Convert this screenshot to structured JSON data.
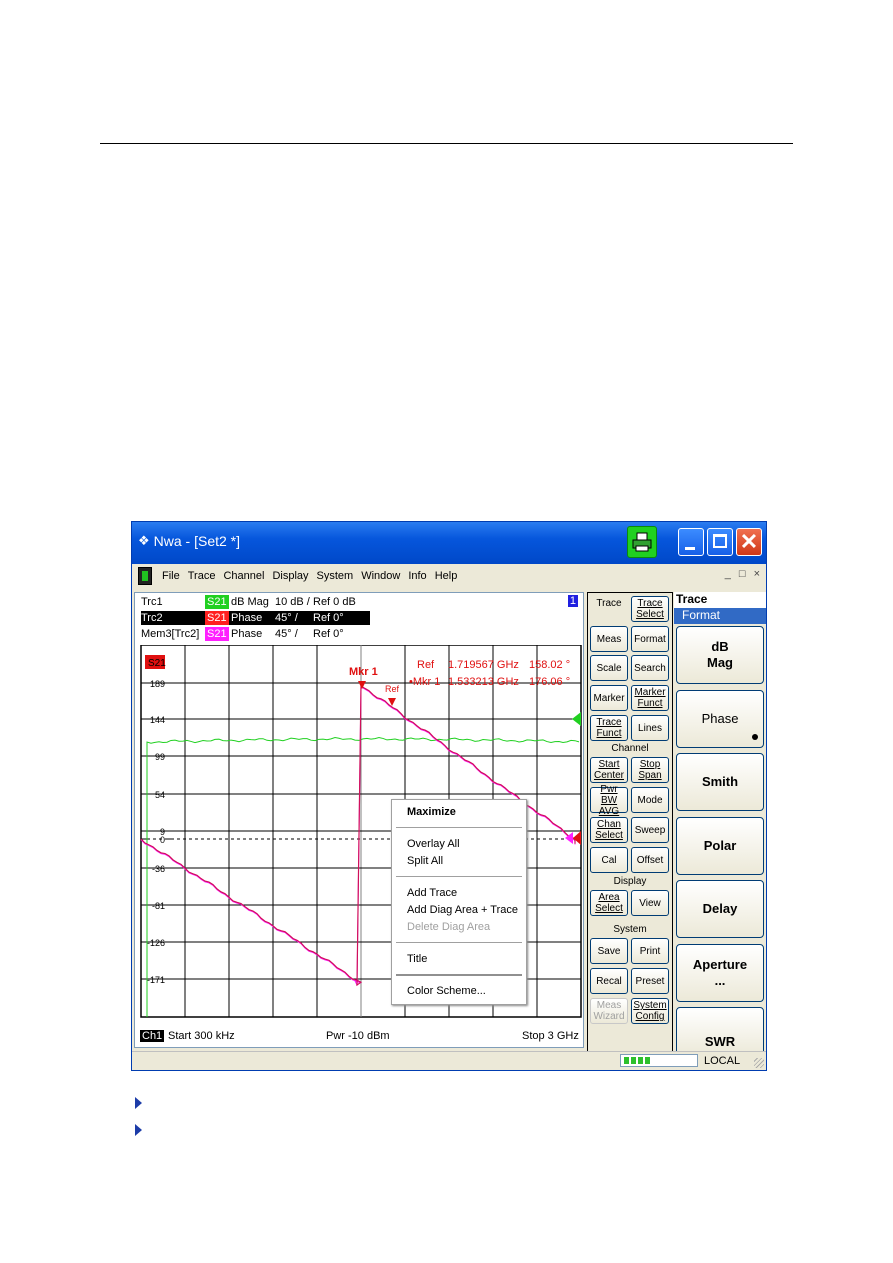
{
  "window": {
    "title": "Nwa - [Set2 *]",
    "app_icon": "rohde-schwarz-diamond-icon"
  },
  "menu": [
    "File",
    "Trace",
    "Channel",
    "Display",
    "System",
    "Window",
    "Info",
    "Help"
  ],
  "mdi_controls": [
    "_",
    "□",
    "×"
  ],
  "traces": [
    {
      "name": "Trc1",
      "param": "S21",
      "param_color": "#20d020",
      "format": "dB Mag",
      "scale": "10 dB /",
      "ref": "Ref 0 dB",
      "selected": false
    },
    {
      "name": "Trc2",
      "param": "S21",
      "param_color": "#ff2020",
      "format": "Phase",
      "scale": "45° /",
      "ref": "Ref 0°",
      "selected": true
    },
    {
      "name": "Mem3[Trc2]",
      "param": "S21",
      "param_color": "#ff20ff",
      "format": "Phase",
      "scale": "45° /",
      "ref": "Ref 0°",
      "selected": false
    }
  ],
  "channel_number": "1",
  "diagram": {
    "active_param_badge": "S21",
    "y_ticks": [
      "189",
      "144",
      "99",
      "54",
      "9",
      "0",
      "-36",
      "-81",
      "-126",
      "-171"
    ],
    "marker_readout": [
      {
        "label": "Ref",
        "freq": "1.719567 GHz",
        "value": "158.02 °"
      },
      {
        "label": "•Mkr 1",
        "freq": "1.533213 GHz",
        "value": "176.06 °"
      }
    ],
    "marker1_label": "Mkr 1",
    "ref_marker_label": "Ref",
    "footer": {
      "channel": "Ch1",
      "start": "Start  300 kHz",
      "power": "Pwr  -10 dBm",
      "stop": "Stop  3 GHz"
    }
  },
  "context_menu": {
    "items": [
      {
        "label": "Maximize",
        "bold": true,
        "disabled": false
      },
      {
        "label": "Overlay All",
        "disabled": false
      },
      {
        "label": "Split All",
        "disabled": false
      },
      {
        "label": "Add Trace",
        "disabled": false
      },
      {
        "label": "Add Diag Area + Trace",
        "disabled": false
      },
      {
        "label": "Delete Diag Area",
        "disabled": true
      },
      {
        "label": "Title",
        "disabled": false
      },
      {
        "label": "Color Scheme...",
        "disabled": false
      }
    ]
  },
  "softkeys": {
    "trace_label": "Trace",
    "trace_select": "Trace Select",
    "meas": "Meas",
    "format": "Format",
    "scale": "Scale",
    "search": "Search",
    "marker": "Marker",
    "marker_funct": "Marker Funct",
    "trace_funct": "Trace Funct",
    "lines": "Lines",
    "channel_label": "Channel",
    "start_center": "Start Center",
    "stop_span": "Stop Span",
    "pwr_bw_avg": "Pwr BW AVG",
    "mode": "Mode",
    "chan_select": "Chan Select",
    "sweep": "Sweep",
    "cal": "Cal",
    "offset": "Offset",
    "display_label": "Display",
    "area_select": "Area Select",
    "view": "View",
    "system_label": "System",
    "save": "Save",
    "print": "Print",
    "recal": "Recal",
    "preset": "Preset",
    "meas_wizard": "Meas Wizard",
    "system_config": "System Config"
  },
  "format_panel": {
    "header1": "Trace",
    "header2": "Format",
    "buttons": [
      "dB\nMag",
      "Phase",
      "Smith",
      "Polar",
      "Delay",
      "Aperture\n...",
      "SWR"
    ],
    "active": "Phase"
  },
  "status_bar": {
    "progress_segments_filled": 4,
    "mode": "LOCAL"
  },
  "colors": {
    "titlebar": "#0656dc",
    "trace1": "#20d020",
    "trace2": "#e0105a",
    "mem3": "#ff20ff",
    "marker": "#e01010",
    "selection": "#316ac5"
  }
}
